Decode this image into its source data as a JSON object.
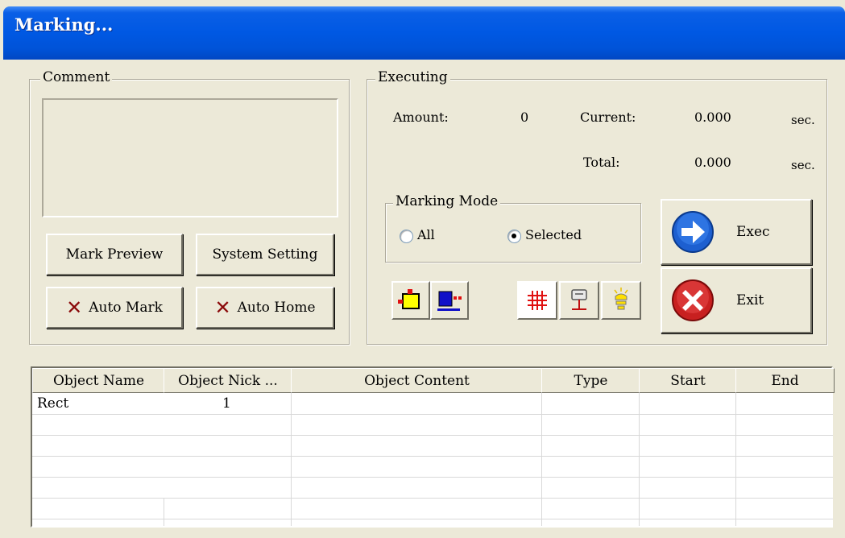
{
  "window": {
    "title": "Marking..."
  },
  "comment": {
    "legend": "Comment",
    "text": "",
    "buttons": {
      "mark_preview": "Mark Preview",
      "system_setting": "System Setting",
      "auto_mark": "Auto Mark",
      "auto_home": "Auto Home"
    }
  },
  "executing": {
    "legend": "Executing",
    "amount_label": "Amount:",
    "amount_value": "0",
    "current_label": "Current:",
    "current_value": "0.000",
    "current_unit": "sec.",
    "total_label": "Total:",
    "total_value": "0.000",
    "total_unit": "sec."
  },
  "marking_mode": {
    "legend": "Marking Mode",
    "options": [
      "All",
      "Selected"
    ],
    "selected": "Selected"
  },
  "actions": {
    "exec": "Exec",
    "exit": "Exit"
  },
  "toolbar_icons": [
    "select-frame-icon",
    "blue-mark-icon",
    "grid-icon",
    "pen-plotter-icon",
    "light-icon"
  ],
  "table": {
    "columns": [
      "Object Name",
      "Object Nick ...",
      "Object Content",
      "Type",
      "Start",
      "End"
    ],
    "rows": [
      [
        "Rect",
        "1",
        "",
        "",
        "",
        ""
      ]
    ]
  },
  "colors": {
    "titlebar": "#0058e3",
    "exec_icon": "#1d5fd0",
    "exit_icon": "#c82020",
    "face": "#ece9d8"
  }
}
